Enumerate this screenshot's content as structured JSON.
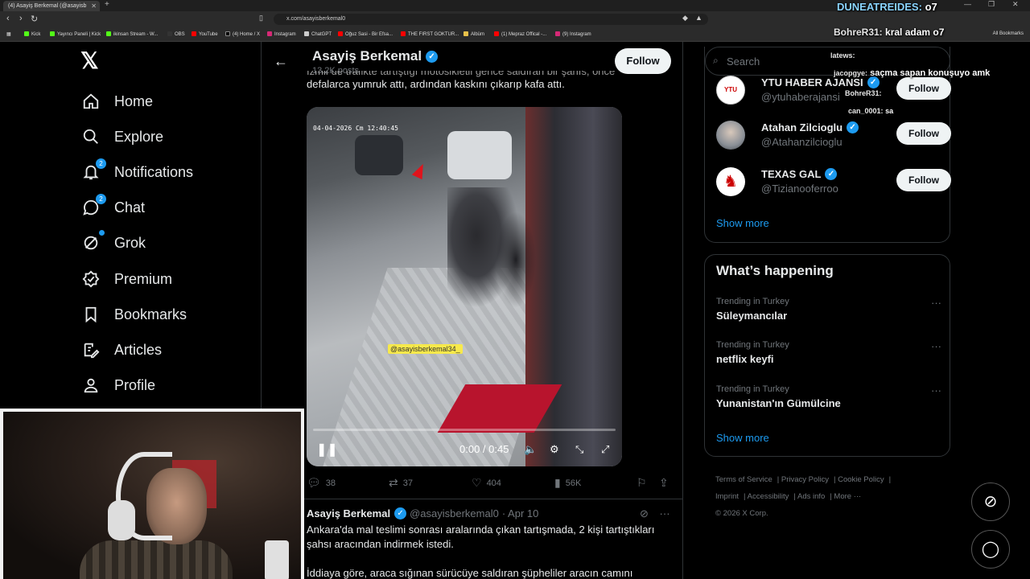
{
  "browser": {
    "tab_title": "(4) Asayiş Berkemal (@asayisb",
    "url": "x.com/asayisberkemal0",
    "bookmarks": [
      "Kick",
      "Yayıncı Paneli | Kick",
      "ikinsan Stream - W...",
      "OBS",
      "YouTube",
      "(4) Home / X",
      "Instagram",
      "ChatGPT",
      "Oğuz Sasi - Bir Efsa...",
      "THE FIRST GOKTUR...",
      "Albüm",
      "(1) Mepraz Offical -...",
      "(9) Instagram"
    ],
    "all_bookmarks": "All Bookmarks"
  },
  "nav": {
    "items": [
      {
        "label": "Home",
        "icon": "home-icon"
      },
      {
        "label": "Explore",
        "icon": "search-icon"
      },
      {
        "label": "Notifications",
        "icon": "bell-icon",
        "badge": "2"
      },
      {
        "label": "Chat",
        "icon": "chat-icon",
        "badge": "2"
      },
      {
        "label": "Grok",
        "icon": "grok-icon"
      },
      {
        "label": "Premium",
        "icon": "premium-icon"
      },
      {
        "label": "Bookmarks",
        "icon": "bookmark-icon"
      },
      {
        "label": "Articles",
        "icon": "articles-icon"
      },
      {
        "label": "Profile",
        "icon": "profile-icon"
      }
    ]
  },
  "header": {
    "name": "Asayiş Berkemal",
    "posts": "13.2K posts",
    "follow": "Follow"
  },
  "tweet1": {
    "text_cut": "İzmir'de trafikte tartıştığı motosikletli gence saldıran bir şahıs, önce",
    "text": "defalarca yumruk attı, ardından kaskını çıkarıp kafa attı.",
    "video": {
      "timestamp": "04-04-2026 Cm 12:40:45",
      "watermark": "@asayisberkemal34_",
      "time": "0:00 / 0:45",
      "progress": 0.0
    },
    "replies": "38",
    "reposts": "37",
    "likes": "404",
    "views": "56K"
  },
  "tweet2": {
    "name": "Asayiş Berkemal",
    "handle": "@asayisberkemal0",
    "date": "· Apr 10",
    "para1": "Ankara'da mal teslimi sonrası aralarında çıkan tartışmada, 2 kişi tartıştıkları şahsı aracından indirmek istedi.",
    "para2": "İddiaya göre, araca sığınan sürücüye saldıran şüpheliler aracın camını"
  },
  "right": {
    "search_placeholder": "Search",
    "accounts": [
      {
        "name": "YTU HABER AJANSI",
        "handle": "@ytuhaberajansi",
        "follow": "Follow",
        "avatar_color": "#ffffff"
      },
      {
        "name": "Atahan Zilcioglu",
        "handle": "@Atahanzilcioglu",
        "follow": "Follow",
        "avatar_color": "#8a8f96"
      },
      {
        "name": "TEXAS GAL",
        "handle": "@Tizianooferroo",
        "follow": "Follow",
        "avatar_color": "#ffffff"
      }
    ],
    "show_more": "Show more",
    "happening_title": "What’s happening",
    "trends": [
      {
        "category": "Trending in Turkey",
        "name": "Süleymancılar"
      },
      {
        "category": "Trending in Turkey",
        "name": "netflix keyfi"
      },
      {
        "category": "Trending in Turkey",
        "name": "Yunanistan'ın Gümülcine"
      }
    ],
    "show_more2": "Show more",
    "footer": [
      "Terms of Service",
      "Privacy Policy",
      "Cookie Policy",
      "Imprint",
      "Accessibility",
      "Ads info",
      "More ···",
      "© 2026 X Corp."
    ]
  },
  "chat_overlay": [
    {
      "user": "DUNEATREIDES:",
      "msg": "o7"
    },
    {
      "user": "BohreR31:",
      "msg": "kral adam o7"
    },
    {
      "user": "latews:",
      "msg": ""
    },
    {
      "user": "jacopgye:",
      "msg": "saçma sapan konuşuyo amk"
    },
    {
      "user": "BohreR31:",
      "msg": ""
    },
    {
      "user": "can_0001:",
      "msg": "sa"
    }
  ],
  "colors": {
    "accent": "#1d9bf0",
    "border": "#2f3336",
    "muted": "#71767b"
  }
}
